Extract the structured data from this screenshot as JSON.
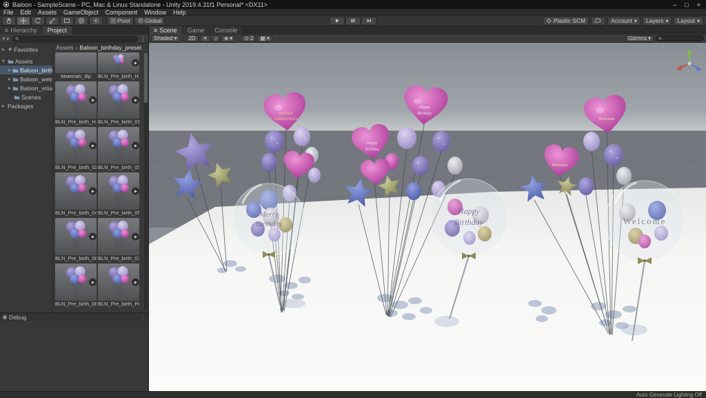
{
  "window": {
    "title": "Baloon - SampleScene - PC, Mac & Linux Standalone - Unity 2019.4.31f1 Personal* <DX11>"
  },
  "menu": {
    "items": [
      "File",
      "Edit",
      "Assets",
      "GameObject",
      "Component",
      "Window",
      "Help"
    ]
  },
  "toolbar": {
    "pivot": "Pivot",
    "global": "Global",
    "plastic": "Plastic SCM",
    "account": "Account",
    "layers": "Layers",
    "layout": "Layout"
  },
  "panels": {
    "hierarchy": "Hierarchy",
    "project": "Project",
    "favorites": "Favorites",
    "debug": "Debug"
  },
  "tree": {
    "assets": "Assets",
    "packages": "Packages",
    "folders": [
      {
        "label": "Baloon_birthday..."
      },
      {
        "label": "Baloon_welcome..."
      },
      {
        "label": "Baloon_xmas_pre..."
      },
      {
        "label": "Scenes"
      }
    ]
  },
  "breadcrumb": {
    "root": "Assets",
    "sep": "›",
    "current": "Baloon_birthday_preset"
  },
  "project": {
    "items": [
      {
        "label": "Materials_Bp"
      },
      {
        "label": "BLN_Pre_birth_H..."
      },
      {
        "label": "BLN_Pre_birth_H..."
      },
      {
        "label": "BLN_Pre_birth_01"
      },
      {
        "label": "BLN_Pre_birth_02"
      },
      {
        "label": "BLN_Pre_birth_03"
      },
      {
        "label": "BLN_Pre_birth_04"
      },
      {
        "label": "BLN_Pre_birth_05"
      },
      {
        "label": "BLN_Pre_birth_06"
      },
      {
        "label": "BLN_Pre_birth_07"
      },
      {
        "label": "BLN_Pre_birth_08"
      },
      {
        "label": "BLN_Pre_birth_Po..."
      }
    ]
  },
  "scene": {
    "tabs": [
      "Scene",
      "Game",
      "Console"
    ],
    "toolbar": {
      "shaded": "Shaded",
      "two_d": "2D",
      "hidden_count": "2",
      "gizmos": "Gizmos"
    },
    "labels": {
      "merry": "MERRY",
      "christmas": "CHRISTMAS",
      "happy": "Happy",
      "birthday": "Birthday",
      "welcome": "Welcome",
      "merry_script": "Merry"
    }
  },
  "icons": {
    "caret_down": "▾",
    "caret_right": "▸",
    "list": "≡",
    "star": "★",
    "plus": "+",
    "menu": "⋮",
    "minimize": "–",
    "maximize": "□",
    "close": "×",
    "sun": "☀",
    "note": "♪",
    "fx": "◈",
    "eye": "⊙",
    "grid": "▦"
  },
  "status": {
    "lighting": "Auto Generate Lighting Off"
  }
}
